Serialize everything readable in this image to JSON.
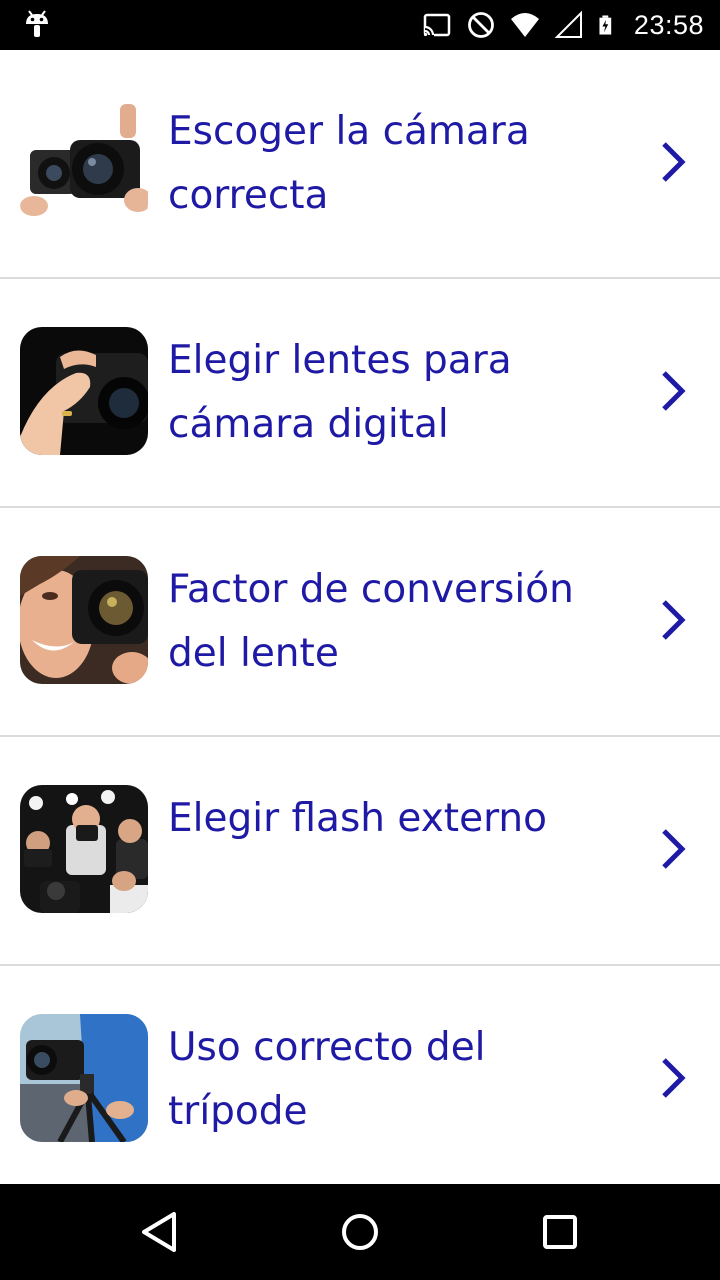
{
  "status_bar": {
    "time": "23:58",
    "icons": [
      "android-debug-icon",
      "cast-icon",
      "do-not-disturb-icon",
      "wifi-icon",
      "signal-icon",
      "battery-charging-icon"
    ]
  },
  "list": {
    "items": [
      {
        "title": "Escoger la cámara correcta",
        "thumbnail": "camera-lenses-thumbnail"
      },
      {
        "title": "Elegir lentes para cámara digital",
        "thumbnail": "hands-camera-thumbnail"
      },
      {
        "title": "Factor de conversión del lente",
        "thumbnail": "woman-camera-thumbnail"
      },
      {
        "title": "Elegir flash externo",
        "thumbnail": "photographers-flash-thumbnail"
      },
      {
        "title": "Uso correcto del trípode",
        "thumbnail": "tripod-thumbnail"
      }
    ]
  },
  "colors": {
    "title": "#1f1aa5",
    "divider": "#dcdcdc",
    "bars": "#000000"
  },
  "nav_bar": {
    "buttons": [
      "back-icon",
      "home-icon",
      "recents-icon"
    ]
  }
}
